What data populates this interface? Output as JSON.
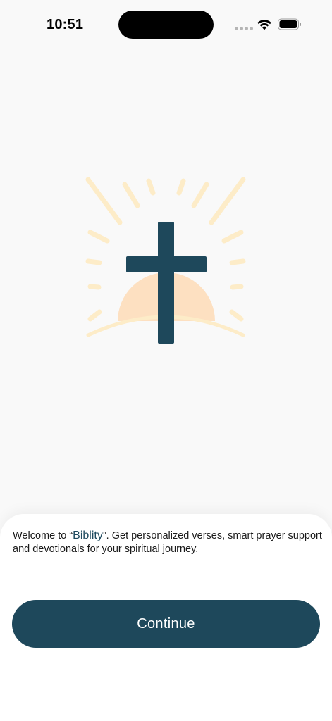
{
  "status_bar": {
    "time": "10:51"
  },
  "illustration": {
    "icon": "cross-sunrise-icon",
    "colors": {
      "rays": "#fdecc8",
      "sun": "#fde0c1",
      "horizon": "#fdecc8",
      "cross": "#1e485b"
    }
  },
  "welcome": {
    "prefix": "Welcome to “",
    "brand": "Biblity",
    "suffix": "”. Get personalized verses, smart prayer support and devotionals for your spiritual journey."
  },
  "continue_button": {
    "label": "Continue"
  },
  "colors": {
    "accent": "#1e485b",
    "background": "#f9f9f9",
    "sheet": "#ffffff"
  }
}
